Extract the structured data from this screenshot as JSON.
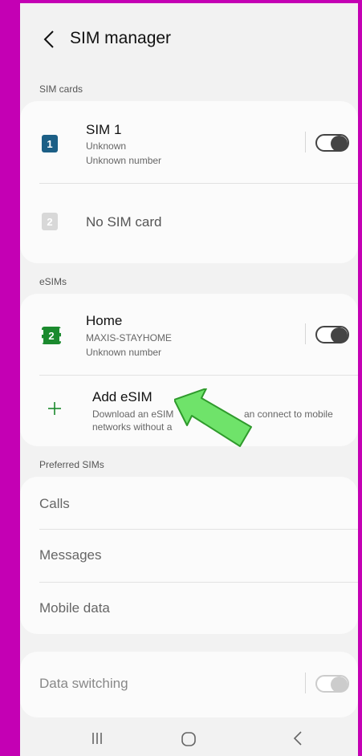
{
  "header": {
    "title": "SIM manager"
  },
  "sections": {
    "sim_cards": "SIM cards",
    "esims": "eSIMs",
    "preferred": "Preferred SIMs"
  },
  "sim1": {
    "badge": "1",
    "name": "SIM 1",
    "line1": "Unknown",
    "line2": "Unknown number",
    "enabled": false
  },
  "sim2": {
    "badge": "2",
    "name": "No SIM card"
  },
  "esim_home": {
    "badge": "2",
    "name": "Home",
    "line1": "MAXIS-STAYHOME",
    "line2": "Unknown number",
    "enabled": false
  },
  "add_esim": {
    "title": "Add eSIM",
    "line1": "Download an eSIM",
    "line1_end": "an connect to mobile",
    "line2": "networks without a"
  },
  "preferred": {
    "calls": "Calls",
    "messages": "Messages",
    "mobile_data": "Mobile data"
  },
  "data_switching": {
    "label": "Data switching",
    "enabled": false
  },
  "colors": {
    "background": "#c400b4",
    "screen": "#f2f2f2",
    "sim1_badge": "#1c5f86",
    "esim_badge": "#1b8a2e",
    "add_plus": "#1b8a2e",
    "arrow_fill": "#6fe36a"
  },
  "icons": {
    "back": "chevron-left-icon",
    "add": "plus-icon",
    "nav_recent": "recent-apps-icon",
    "nav_home": "home-icon",
    "nav_back": "back-icon"
  }
}
